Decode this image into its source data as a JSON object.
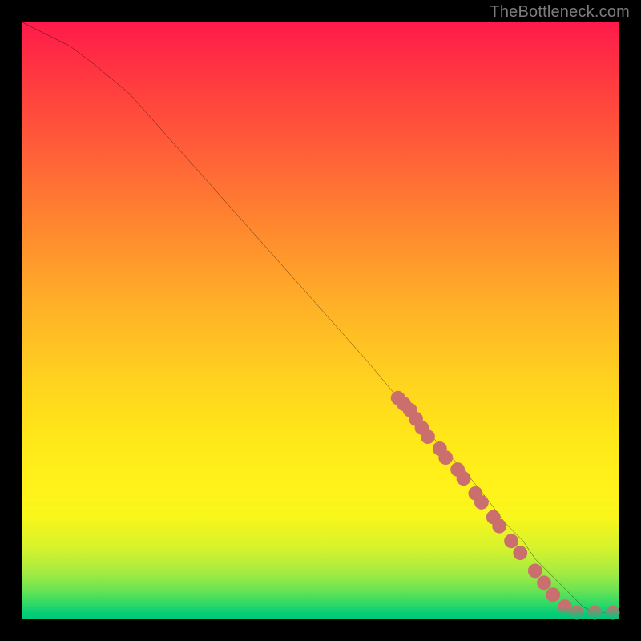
{
  "watermark": "TheBottleneck.com",
  "chart_data": {
    "type": "line",
    "title": "",
    "xlabel": "",
    "ylabel": "",
    "xlim": [
      0,
      100
    ],
    "ylim": [
      0,
      100
    ],
    "grid": false,
    "series": [
      {
        "name": "curve",
        "color": "#000000",
        "x": [
          0,
          4,
          8,
          12,
          18,
          26,
          34,
          42,
          50,
          58,
          63,
          66,
          70,
          74,
          78,
          81,
          84,
          86,
          88,
          90,
          92,
          94,
          96,
          98,
          100
        ],
        "y": [
          100,
          98,
          96,
          93,
          88,
          79,
          70,
          61,
          52,
          43,
          37,
          34,
          29,
          25,
          20,
          16,
          13,
          10,
          8,
          6,
          4,
          2,
          1,
          1,
          1
        ]
      }
    ],
    "markers": [
      {
        "name": "dotted-segment",
        "color": "#cb6e6e",
        "radius_pct": 1.2,
        "points": [
          {
            "x": 63,
            "y": 37
          },
          {
            "x": 64,
            "y": 36
          },
          {
            "x": 65,
            "y": 35
          },
          {
            "x": 66,
            "y": 33.5
          },
          {
            "x": 67,
            "y": 32
          },
          {
            "x": 68,
            "y": 30.5
          },
          {
            "x": 70,
            "y": 28.5
          },
          {
            "x": 71,
            "y": 27
          },
          {
            "x": 73,
            "y": 25
          },
          {
            "x": 74,
            "y": 23.5
          },
          {
            "x": 76,
            "y": 21
          },
          {
            "x": 77,
            "y": 19.5
          },
          {
            "x": 79,
            "y": 17
          },
          {
            "x": 80,
            "y": 15.5
          },
          {
            "x": 82,
            "y": 13
          },
          {
            "x": 83.5,
            "y": 11
          },
          {
            "x": 86,
            "y": 8
          },
          {
            "x": 87.5,
            "y": 6
          },
          {
            "x": 89,
            "y": 4
          },
          {
            "x": 91,
            "y": 2
          },
          {
            "x": 93,
            "y": 1
          },
          {
            "x": 96,
            "y": 1
          },
          {
            "x": 99,
            "y": 1
          }
        ]
      }
    ]
  }
}
